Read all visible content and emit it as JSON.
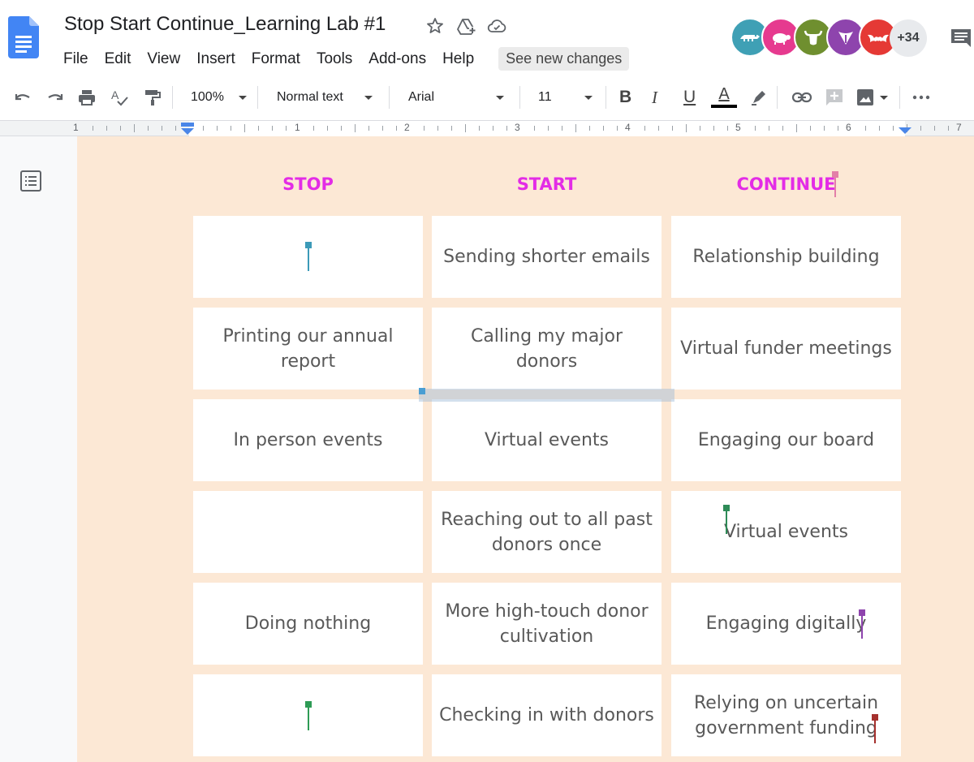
{
  "doc": {
    "title": "Stop Start Continue_Learning Lab #1"
  },
  "menu": [
    "File",
    "Edit",
    "View",
    "Insert",
    "Format",
    "Tools",
    "Add-ons",
    "Help"
  ],
  "see_changes": "See new changes",
  "collaborators": {
    "more_count": "+34",
    "avatars": [
      {
        "icon": "crocodile-icon",
        "color": "#3fa0b5"
      },
      {
        "icon": "turtle-icon",
        "color": "#e63a8f"
      },
      {
        "icon": "buffalo-icon",
        "color": "#6f8f2f"
      },
      {
        "icon": "badger-icon",
        "color": "#8e44ad"
      },
      {
        "icon": "bat-icon",
        "color": "#e53935"
      }
    ]
  },
  "toolbar": {
    "zoom": "100%",
    "style": "Normal text",
    "font": "Arial",
    "size": "11",
    "bold": "B",
    "italic": "I",
    "underline": "U",
    "text_color": "A"
  },
  "ruler": [
    "1",
    "1",
    "2",
    "3",
    "4",
    "5",
    "6",
    "7"
  ],
  "table": {
    "headers": [
      "STOP",
      "START",
      "CONTINUE"
    ],
    "rows": [
      [
        "",
        "Sending shorter emails",
        "Relationship building"
      ],
      [
        "Printing our annual report",
        "Calling my major donors",
        "Virtual funder meetings"
      ],
      [
        "In person events",
        "Virtual events",
        "Engaging our board"
      ],
      [
        "",
        "Reaching out to all past donors once",
        "Virtual events"
      ],
      [
        "Doing nothing",
        "More high-touch donor cultivation",
        "Engaging digitally"
      ],
      [
        "",
        "Checking in with donors",
        "Relying on uncertain government funding"
      ]
    ]
  },
  "colors": {
    "header_text": "#e32ce6",
    "page_background": "#fce8d5",
    "cell_text": "#595959"
  }
}
